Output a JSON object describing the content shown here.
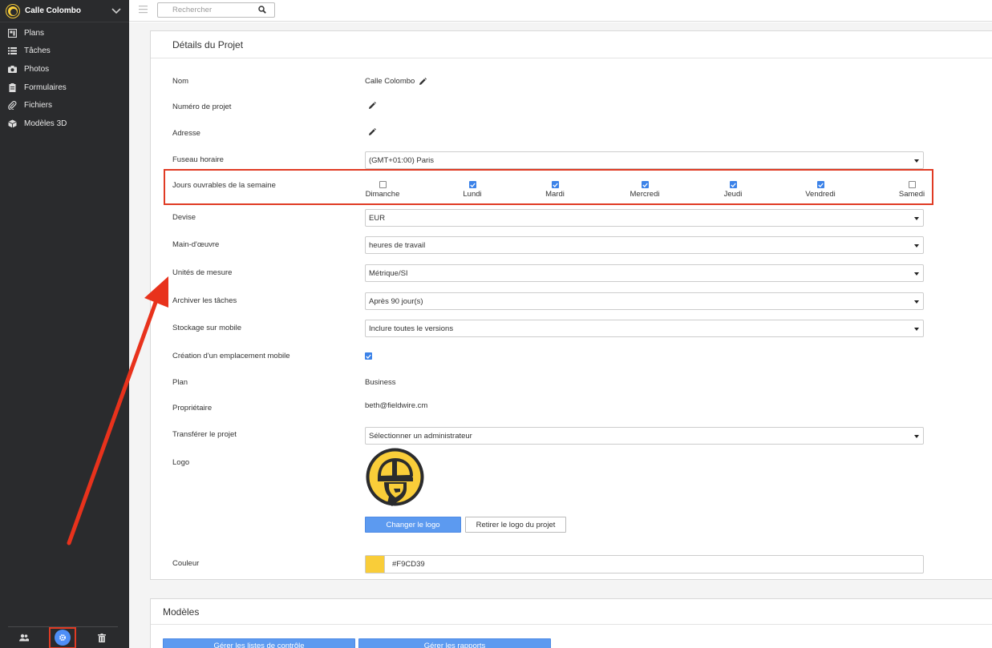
{
  "colors": {
    "sidebar_bg": "#2a2b2d",
    "accent": "#5c9af0",
    "highlight": "#e03b24",
    "project_color": "#F9CD39"
  },
  "sidebar": {
    "project_name": "Calle Colombo",
    "items": [
      {
        "label": "Plans",
        "icon": "plans-icon"
      },
      {
        "label": "Tâches",
        "icon": "list-icon"
      },
      {
        "label": "Photos",
        "icon": "camera-icon"
      },
      {
        "label": "Formulaires",
        "icon": "clipboard-icon"
      },
      {
        "label": "Fichiers",
        "icon": "paperclip-icon"
      },
      {
        "label": "Modèles 3D",
        "icon": "cube-icon"
      }
    ]
  },
  "search": {
    "placeholder": "Rechercher"
  },
  "details": {
    "title": "Détails du Projet",
    "name_label": "Nom",
    "name_value": "Calle Colombo",
    "project_number_label": "Numéro de projet",
    "address_label": "Adresse",
    "timezone_label": "Fuseau horaire",
    "timezone_value": "(GMT+01:00) Paris",
    "workdays_label": "Jours ouvrables de la semaine",
    "days": [
      {
        "label": "Dimanche",
        "checked": false
      },
      {
        "label": "Lundi",
        "checked": true
      },
      {
        "label": "Mardi",
        "checked": true
      },
      {
        "label": "Mercredi",
        "checked": true
      },
      {
        "label": "Jeudi",
        "checked": true
      },
      {
        "label": "Vendredi",
        "checked": true
      },
      {
        "label": "Samedi",
        "checked": false
      }
    ],
    "currency_label": "Devise",
    "currency_value": "EUR",
    "labor_label": "Main-d'œuvre",
    "labor_value": "heures de travail",
    "units_label": "Unités de mesure",
    "units_value": "Métrique/SI",
    "archive_label": "Archiver les tâches",
    "archive_value": "Après 90 jour(s)",
    "mobile_storage_label": "Stockage sur mobile",
    "mobile_storage_value": "Inclure toutes le versions",
    "mobile_location_label": "Création d'un emplacement mobile",
    "plan_label": "Plan",
    "plan_value": "Business",
    "owner_label": "Propriétaire",
    "owner_value": "beth@fieldwire.cm",
    "transfer_label": "Transférer le projet",
    "transfer_value": "Sélectionner un administrateur",
    "logo_label": "Logo",
    "change_logo": "Changer le logo",
    "remove_logo": "Retirer le logo du projet",
    "color_label": "Couleur",
    "color_value": "#F9CD39"
  },
  "templates": {
    "title": "Modèles",
    "btn1": "Gérer les listes de contrôle",
    "btn2": "Gérer les rapports"
  }
}
